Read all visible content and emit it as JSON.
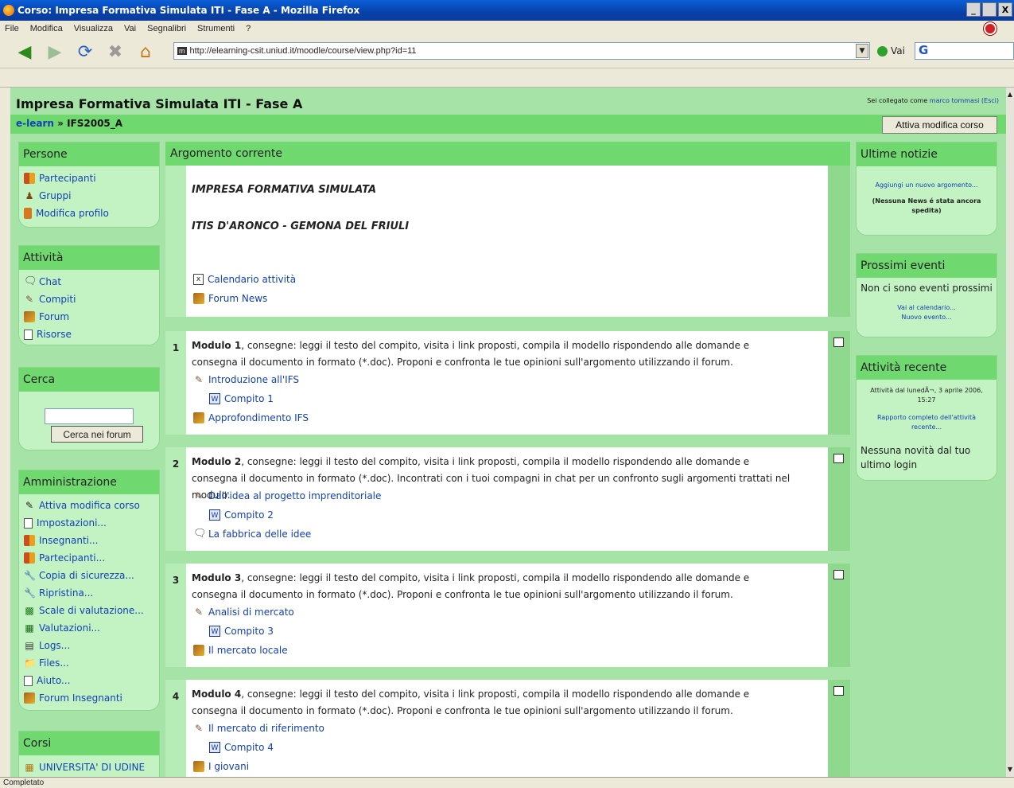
{
  "window": {
    "title": "Corso: Impresa Formativa Simulata ITI - Fase A - Mozilla Firefox",
    "controls": [
      "_",
      " ",
      "X"
    ]
  },
  "menu": [
    "File",
    "Modifica",
    "Visualizza",
    "Vai",
    "Segnalibri",
    "Strumenti",
    "?"
  ],
  "toolbar": {
    "url": "http://elearning-csit.uniud.it/moodle/course/view.php?id=11",
    "site_badge": "m",
    "go_label": "Vai",
    "search_glyph": "G"
  },
  "status": "Completato",
  "header": {
    "course_title": "Impresa Formativa Simulata ITI - Fase A",
    "login_prefix": "Sei collegato come",
    "user": "marco tommasi",
    "logout": "(Esci)",
    "crumb_root": "e-learn",
    "crumb_sep": "»",
    "crumb_current": "IFS2005_A",
    "edit_button": "Attiva modifica corso"
  },
  "left": {
    "persone": {
      "title": "Persone",
      "items": [
        "Partecipanti",
        "Gruppi",
        "Modifica profilo"
      ]
    },
    "attivita": {
      "title": "Attività",
      "items": [
        "Chat",
        "Compiti",
        "Forum",
        "Risorse"
      ]
    },
    "cerca": {
      "title": "Cerca",
      "button": "Cerca nei forum"
    },
    "admin": {
      "title": "Amministrazione",
      "items": [
        "Attiva modifica corso",
        "Impostazioni...",
        "Insegnanti...",
        "Partecipanti...",
        "Copia di sicurezza...",
        "Ripristina...",
        "Scale di valutazione...",
        "Valutazioni...",
        "Logs...",
        "Files...",
        "Aiuto...",
        "Forum Insegnanti"
      ]
    },
    "corsi": {
      "title": "Corsi",
      "items": [
        "UNIVERSITA' DI UDINE"
      ]
    }
  },
  "main": {
    "heading": "Argomento corrente",
    "intro": {
      "line1": "IMPRESA FORMATIVA SIMULATA",
      "line2": "ITIS D'ARONCO - GEMONA DEL FRIULI",
      "cal": "Calendario attività",
      "news": "Forum News"
    },
    "modules": [
      {
        "num": "1",
        "bold": "Modulo 1",
        "text": ", consegne: leggi il testo del compito, visita i link proposti, compila il modello rispondendo alle domande e consegna il documento in formato (*.doc). Proponi e confronta le tue opinioni sull'argomento utilizzando il forum.",
        "a": "Introduzione all'IFS",
        "b": "Compito 1",
        "c": "Approfondimento IFS"
      },
      {
        "num": "2",
        "bold": "Modulo 2",
        "text": ", consegne: leggi il testo del compito, visita i link proposti, compila il modello rispondendo alle domande e consegna il documento in formato (*.doc). Incontrati con i tuoi compagni in chat per un confronto sugli argomenti trattati nel modulo.",
        "a": "Dall'idea al progetto imprenditoriale",
        "b": "Compito 2",
        "c": "La fabbrica delle idee"
      },
      {
        "num": "3",
        "bold": "Modulo 3",
        "text": ", consegne: leggi il testo del compito, visita i link proposti, compila il modello rispondendo alle domande e consegna il documento in formato (*.doc). Proponi e confronta le tue opinioni sull'argomento utilizzando il forum.",
        "a": "Analisi di mercato",
        "b": "Compito 3",
        "c": "Il mercato locale"
      },
      {
        "num": "4",
        "bold": "Modulo 4",
        "text": ", consegne: leggi il testo del compito, visita i link proposti, compila il modello rispondendo alle domande e consegna il documento in formato (*.doc). Proponi e confronta le tue opinioni sull'argomento utilizzando il forum.",
        "a": "Il mercato di riferimento",
        "b": "Compito 4",
        "c": "I giovani"
      }
    ]
  },
  "right": {
    "news": {
      "title": "Ultime notizie",
      "add": "Aggiungi un nuovo argomento...",
      "none": "(Nessuna News é stata ancora spedita)"
    },
    "events": {
      "title": "Prossimi eventi",
      "none": "Non ci sono eventi prossimi",
      "cal": "Vai al calendario...",
      "new": "Nuovo evento..."
    },
    "recent": {
      "title": "Attività recente",
      "since": "Attività dal lunedÃ¬, 3 aprile 2006, 15:27",
      "report": "Rapporto completo dell'attività recente...",
      "none": "Nessuna novità dal tuo ultimo login"
    }
  }
}
